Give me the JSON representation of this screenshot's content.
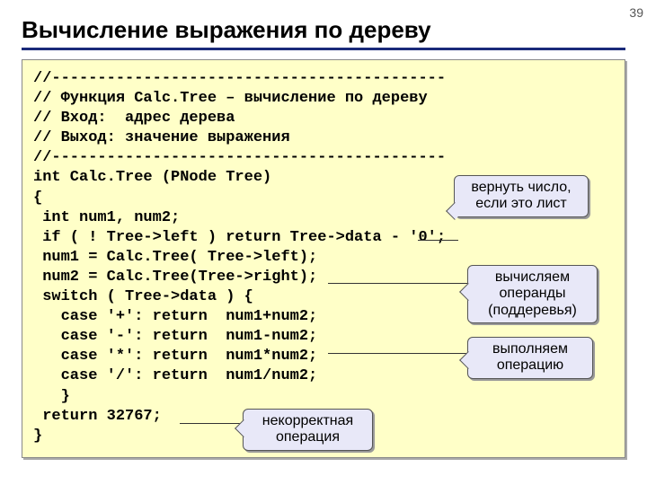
{
  "page_number": "39",
  "title": "Вычисление выражения по дереву",
  "code": {
    "l1": "//-------------------------------------------",
    "l2": "// Функция Calc.Tree – вычисление по дереву",
    "l3": "// Вход:  адрес дерева",
    "l4": "// Выход: значение выражения",
    "l5": "//-------------------------------------------",
    "l6": "int Calc.Tree (PNode Tree)",
    "l7": "{",
    "l8": " int num1, num2;",
    "l9": " if ( ! Tree->left ) return Tree->data - '0';",
    "l10": " num1 = Calc.Tree( Tree->left);",
    "l11": " num2 = Calc.Tree(Tree->right);",
    "l12": " switch ( Tree->data ) {",
    "l13": "   case '+': return  num1+num2;",
    "l14": "   case '-': return  num1-num2;",
    "l15": "   case '*': return  num1*num2;",
    "l16": "   case '/': return  num1/num2;",
    "l17": "   }",
    "l18": " return 32767;",
    "l19": "}"
  },
  "callouts": {
    "c1_line1": "вернуть число,",
    "c1_line2": "если это лист",
    "c2_line1": "вычисляем",
    "c2_line2": "операнды",
    "c2_line3": "(поддеревья)",
    "c3_line1": "выполняем",
    "c3_line2": "операцию",
    "c4_line1": "некорректная",
    "c4_line2": "операция"
  }
}
